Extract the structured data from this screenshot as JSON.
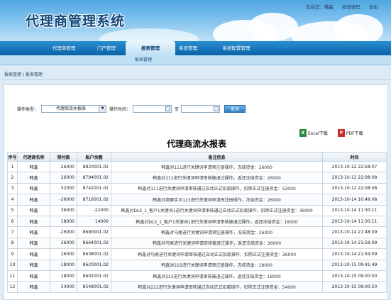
{
  "header": {
    "title": "代理商管理系统",
    "links": [
      "欢迎您：韩磊",
      "修改密码",
      "退出"
    ]
  },
  "nav": {
    "items": [
      "代理商管理",
      "门户管理",
      "报表管理",
      "系统管理",
      "系统配置管理"
    ],
    "active": "报表管理",
    "sub_items": [
      "报表管理"
    ]
  },
  "breadcrumb": "报表管理 \\ 报表管理",
  "filters": {
    "type_label": "操作类型：",
    "type_value": "代理商流水报表",
    "time_label": "操作时间：",
    "to_label": "至",
    "query_label": "查询"
  },
  "exports": {
    "excel_label": "Excel下载",
    "pdf_label": "PDF下载"
  },
  "report": {
    "title": "代理商流水报表",
    "columns": [
      "序号",
      "代理商名称",
      "预付款",
      "账户余额",
      "备注信息",
      "时间"
    ],
    "rows": [
      [
        "1",
        "韩鑫",
        "-26000",
        "8820001.02",
        "韩鑫对111进行关键词申请预注册操作，冻结资金：26000",
        "2013-10-12 22:58:07"
      ],
      [
        "2",
        "韩鑫",
        "26000",
        "8794001.02",
        "韩鑫对111进行关键词申请审核被退过操作，返还冻结资金：26000",
        "2013-10-12 22:08:08"
      ],
      [
        "3",
        "韩鑫",
        "52000",
        "8742001.02",
        "韩鑫对111进行关键词申请审核通过自动正式扣款操作，扣除正式注册资金：52000",
        "2013-10-12 22:08:08"
      ],
      [
        "4",
        "韩鑫",
        "-26000",
        "8716001.02",
        "韩鑫对商聊实业123进行关键词申请预注册操作，冻结资金：26000",
        "2013-10-14 10:49:08"
      ],
      [
        "5",
        "韩鑫",
        "36000",
        "-22000",
        "韩鑫对DLS_1_客户1关键词1进行关键词申请审核通过自动正式扣款操作，扣除正式注册资金：36000",
        "2013-10-14 11:30:11"
      ],
      [
        "6",
        "韩鑫",
        "18000",
        "14000",
        "韩鑫对DLS_1_客户1关键词1进行关键词申请审核被退过操作，返还冻结资金：18000",
        "2013-10-14 11:30:11"
      ],
      [
        "7",
        "韩鑫",
        "-26000",
        "8690001.02",
        "韩鑫对马尾进行关键词申请预注册操作，冻结资金：26000",
        "2013-10-14 21:48:09"
      ],
      [
        "8",
        "韩鑫",
        "26000",
        "8664001.02",
        "韩鑫对马尾进行关键词申请审核被退过操作，返还冻结资金：26000",
        "2013-10-14 21:59:09"
      ],
      [
        "9",
        "韩鑫",
        "26000",
        "8638001.02",
        "韩鑫对马尾进行关键词申请审核通过自动正式扣款操作，扣除正式注册资金：26000",
        "2013-10-14 21:59:09"
      ],
      [
        "10",
        "韩鑫",
        "-18000",
        "8620001.02",
        "韩鑫对222进行关键词申请预注册操作，冻结资金：18000",
        "2013-10-15 09:41:49"
      ],
      [
        "11",
        "韩鑫",
        "18000",
        "8602001.02",
        "韩鑫对222进行关键词申请审核被退过操作，返还冻结资金：18000",
        "2013-10-15 09:00:50"
      ],
      [
        "12",
        "韩鑫",
        "54000",
        "8548001.02",
        "韩鑫对222进行关键词申请审核通过自动正式扣款操作，扣除正式注册资金：54000",
        "2013-10-15 09:00:50"
      ]
    ]
  },
  "colors": {
    "nav_dark": "#0b62a8",
    "title_blue": "#12477a",
    "excel_green": "#2e8b3a",
    "pdf_red": "#c8302a"
  }
}
